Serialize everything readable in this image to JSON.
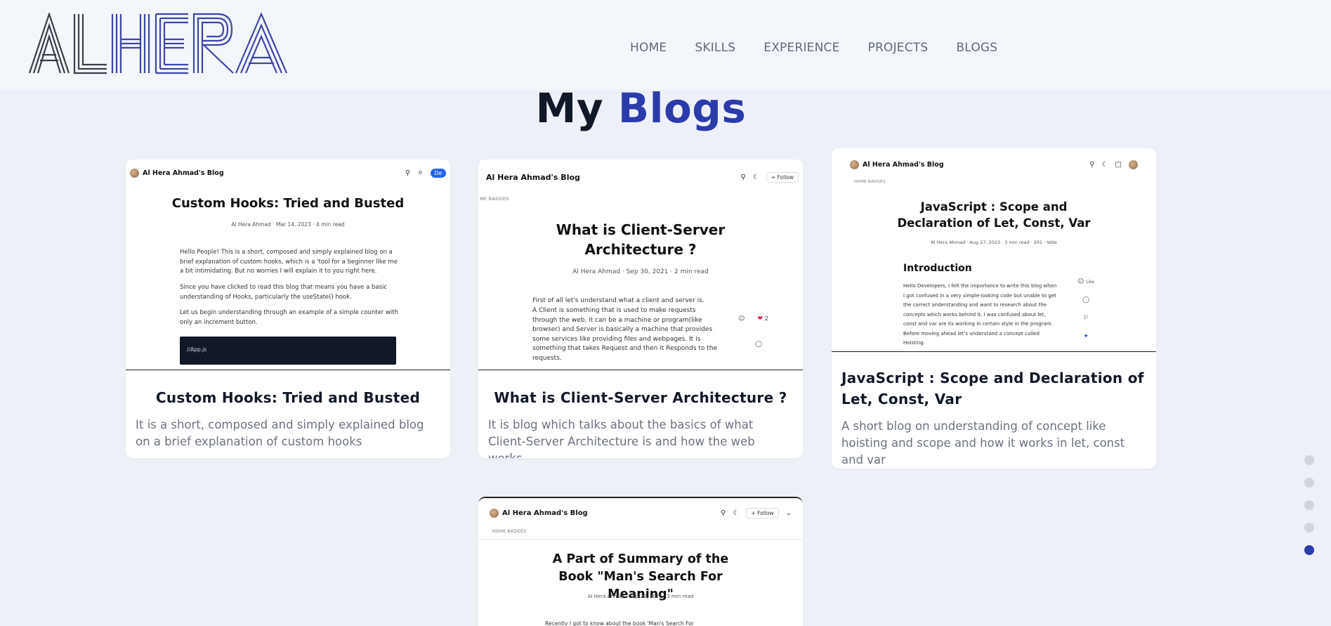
{
  "brand": {
    "logo_text": "ALHERA"
  },
  "nav": {
    "items": [
      "HOME",
      "SKILLS",
      "EXPERIENCE",
      "PROJECTS",
      "BLOGS"
    ]
  },
  "section": {
    "title_plain": "My",
    "title_accent": "Blogs"
  },
  "cards": [
    {
      "title": "Custom Hooks: Tried and Busted",
      "description": "It is a short, composed and simply explained blog on a brief explanation of custom hooks",
      "preview": {
        "brand": "Al Hera Ahmad's Blog",
        "button": "De",
        "title": "Custom Hooks: Tried and Busted",
        "meta": "Al Hera Ahmad · Mar 14, 2023 · 4 min read",
        "paragraphs": [
          "Hello People! This is a short, composed and simply explained blog on a brief explanation of custom hooks, which is a 'tool for a beginner like me a bit intimidating. But no worries I will explain it to you right here.",
          "Since you have clicked to read this blog that means you have a basic understanding of Hooks, particularly the useState() hook.",
          "Let us begin understanding through an example of a simple counter with only an increment button."
        ],
        "code": "//App.js"
      }
    },
    {
      "title": "What is Client-Server Architecture ?",
      "description": "It is blog which talks about the basics of what Client-Server Architecture is and how the web works.",
      "preview": {
        "brand": "Al Hera Ahmad's Blog",
        "button": "Follow",
        "subnav": "ME    BADGES",
        "title": "What is Client-Server Architecture ?",
        "meta": "Al Hera Ahmad · Sep 30, 2021 · 2 min read",
        "paragraphs": [
          "First of all let's understand what a client and server is.",
          "A Client is something that is used to make requests through the web, it can be a machine or program(like browser) and Server is basically a machine that provides some services like providing files and webpages. It is something that takes Request and then it Responds to the requests."
        ],
        "likes": "2"
      }
    },
    {
      "title": "JavaScript : Scope and Declaration of Let, Const, Var",
      "description": "A short blog on understanding of concept like hoisting and scope and how it works in let, const and var",
      "preview": {
        "brand": "Al Hera Ahmad's Blog",
        "subnav": "HOME    BADGES",
        "title": "JavaScript : Scope and Declaration of Let, Const, Var",
        "meta": "Al Hera Ahmad · Aug 27, 2023 · 3 min read · 201 · Vote",
        "heading": "Introduction",
        "paragraph": "Hello Developers, I felt the importance to write this blog when I got confused in a very simple-looking code but unable to get the correct understanding and want to research about the concepts which works behind it. I was confused about let, const and var are its working in certain style in the program. Before moving ahead let's understand a concept called Hoisting.",
        "like": "Like"
      }
    },
    {
      "title": "",
      "description": "",
      "preview": {
        "brand": "Al Hera Ahmad's Blog",
        "button": "Follow",
        "subnav": "HOME    BADGES",
        "title": "A Part of Summary of the Book \"Man's Search For Meaning\"",
        "meta": "Al Hera Ahmad · Sep 20, 2021 · 3 min read",
        "paragraph": "Recently I got to know about the book 'Man's Search For"
      }
    }
  ],
  "pager": {
    "count": 5,
    "active_index": 4
  }
}
